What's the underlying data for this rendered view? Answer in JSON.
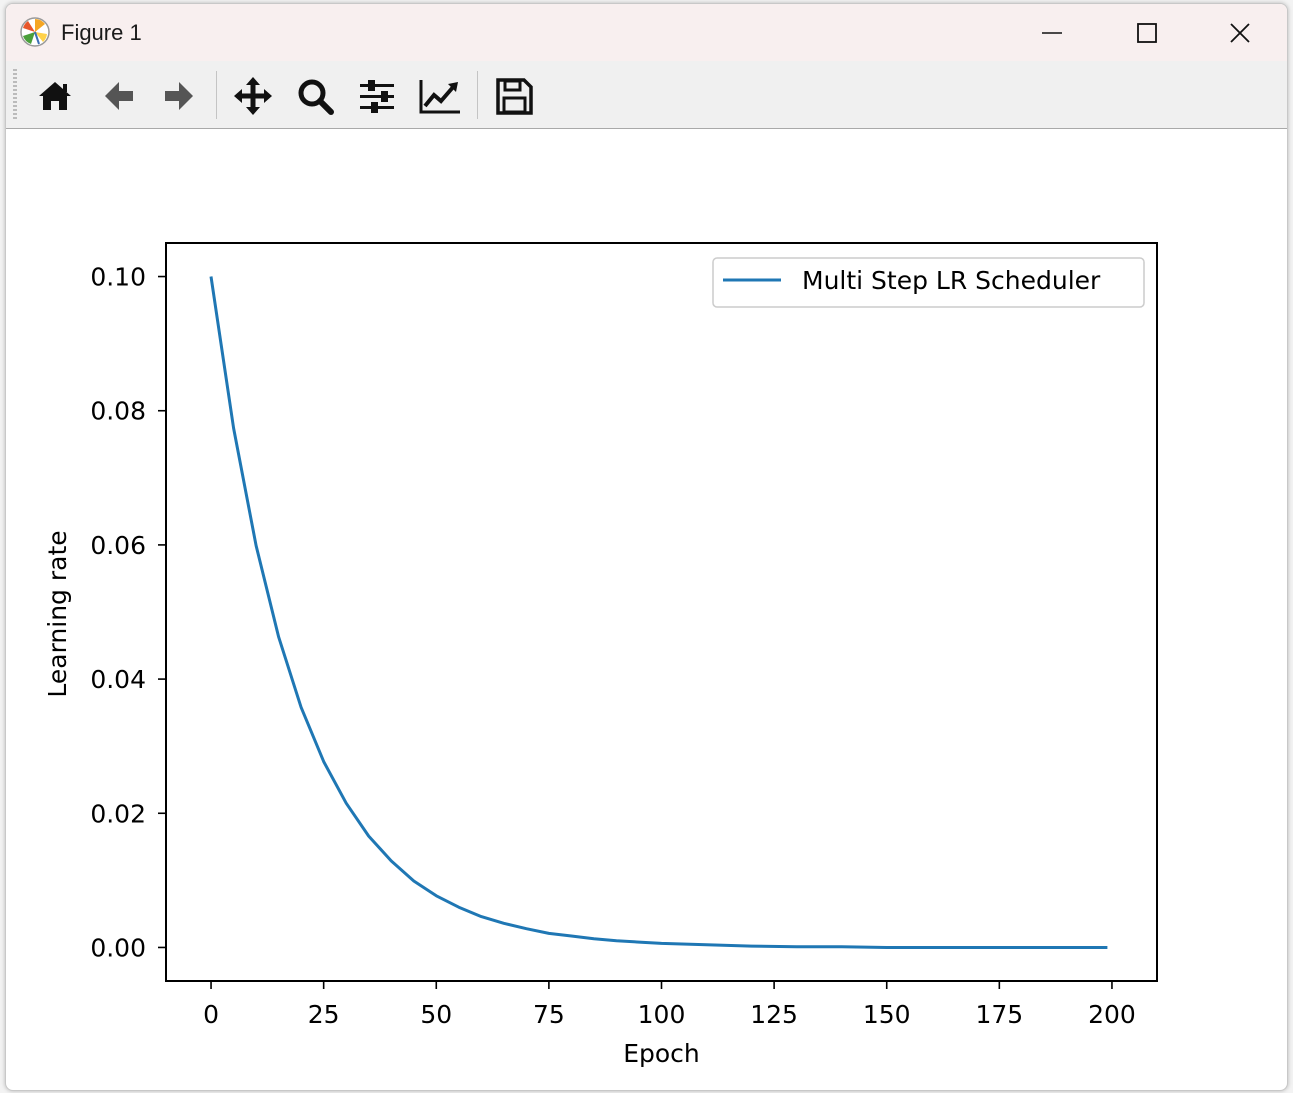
{
  "window": {
    "title": "Figure 1"
  },
  "toolbar": {
    "buttons": [
      {
        "name": "home-icon"
      },
      {
        "name": "back-icon"
      },
      {
        "name": "forward-icon"
      },
      {
        "name": "pan-icon"
      },
      {
        "name": "zoom-icon"
      },
      {
        "name": "configure-subplots-icon"
      },
      {
        "name": "edit-axis-icon"
      },
      {
        "name": "save-icon"
      }
    ]
  },
  "colors": {
    "line": "#1f77b4",
    "axes": "#000000",
    "background": "#ffffff"
  },
  "chart_data": {
    "type": "line",
    "title": "",
    "xlabel": "Epoch",
    "ylabel": "Learning rate",
    "xlim": [
      -10,
      210
    ],
    "ylim": [
      -0.005,
      0.105
    ],
    "xticks": [
      0,
      25,
      50,
      75,
      100,
      125,
      150,
      175,
      200
    ],
    "xtick_labels": [
      "0",
      "25",
      "50",
      "75",
      "100",
      "125",
      "150",
      "175",
      "200"
    ],
    "yticks": [
      0.0,
      0.02,
      0.04,
      0.06,
      0.08,
      0.1
    ],
    "ytick_labels": [
      "0.00",
      "0.02",
      "0.04",
      "0.06",
      "0.08",
      "0.10"
    ],
    "grid": false,
    "legend": "upper right",
    "series": [
      {
        "name": "Multi Step LR Scheduler",
        "color": "#1f77b4",
        "x": [
          0,
          5,
          10,
          15,
          20,
          25,
          30,
          35,
          40,
          45,
          50,
          55,
          60,
          65,
          70,
          75,
          80,
          85,
          90,
          95,
          100,
          110,
          120,
          130,
          140,
          150,
          160,
          170,
          180,
          190,
          199
        ],
        "y": [
          0.1,
          0.0774,
          0.0599,
          0.0463,
          0.0358,
          0.0277,
          0.0215,
          0.0166,
          0.0129,
          0.0099,
          0.0077,
          0.006,
          0.0046,
          0.0036,
          0.0028,
          0.0021,
          0.0017,
          0.0013,
          0.001,
          0.0008,
          0.0006,
          0.0004,
          0.0002,
          0.0001,
          0.0001,
          0.0,
          0.0,
          0.0,
          0.0,
          0.0,
          0.0
        ]
      }
    ]
  }
}
